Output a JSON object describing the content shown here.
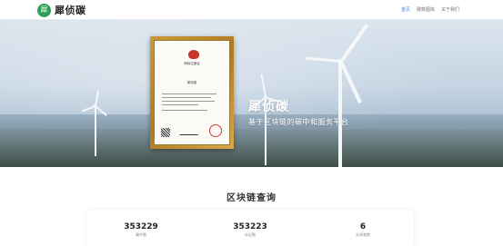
{
  "brand": {
    "name": "犀侦碳",
    "logo_glyph": "犀",
    "color": "#2f9f58"
  },
  "nav": {
    "items": [
      {
        "label": "首页",
        "active": true
      },
      {
        "label": "碳数图库",
        "active": false
      },
      {
        "label": "关于我们",
        "active": false
      }
    ],
    "active_color": "#3b86d8"
  },
  "hero": {
    "title": "犀侦碳",
    "subtitle": "基于区块链的碳中和服务平台",
    "certificate": {
      "title": "商标注册证",
      "name": "犀侦碳"
    }
  },
  "section": {
    "title": "区块链查询"
  },
  "stats": [
    {
      "value": "353229",
      "label": "事件数"
    },
    {
      "value": "353223",
      "label": "存证数"
    },
    {
      "value": "6",
      "label": "交易笔数"
    }
  ]
}
